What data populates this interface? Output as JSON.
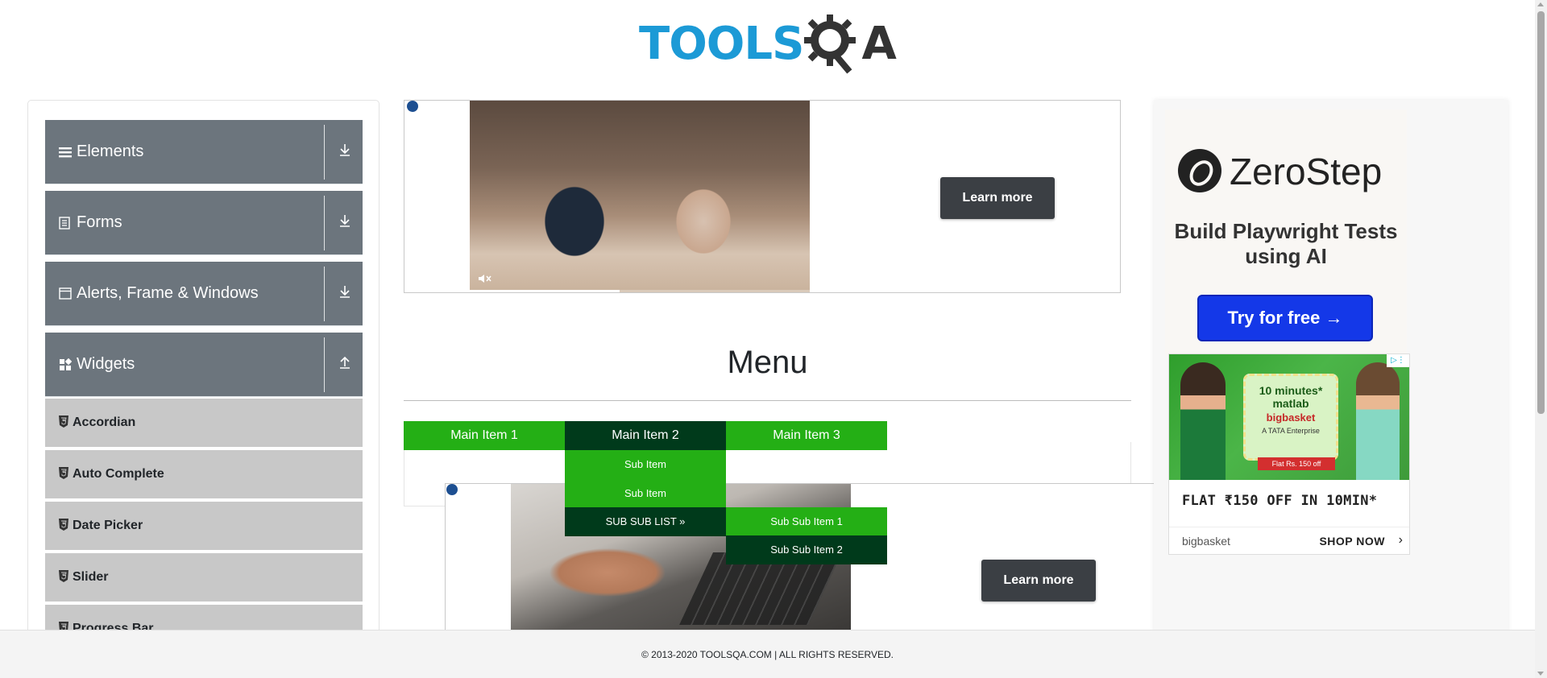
{
  "header": {
    "logo_text_blue": "TOOLS",
    "logo_text_dark": "A"
  },
  "sidebar": {
    "groups": [
      {
        "label": "Elements",
        "icon": "bars-icon",
        "arrow": "download-icon"
      },
      {
        "label": "Forms",
        "icon": "document-icon",
        "arrow": "download-icon"
      },
      {
        "label": "Alerts, Frame & Windows",
        "icon": "window-icon",
        "arrow": "download-icon"
      },
      {
        "label": "Widgets",
        "icon": "widgets-icon",
        "arrow": "upload-icon"
      }
    ],
    "widget_items": [
      {
        "label": "Accordian"
      },
      {
        "label": "Auto Complete"
      },
      {
        "label": "Date Picker"
      },
      {
        "label": "Slider"
      },
      {
        "label": "Progress Bar"
      }
    ]
  },
  "top_ad": {
    "button_label": "Learn more",
    "video_progress": 0.44
  },
  "main": {
    "title": "Menu"
  },
  "menu": {
    "main_items": [
      "Main Item 1",
      "Main Item 2",
      "Main Item 3"
    ],
    "sub_items": [
      "Sub Item",
      "Sub Item",
      "SUB SUB LIST »"
    ],
    "sub_sub_items": [
      "Sub Sub Item 1",
      "Sub Sub Item 2"
    ]
  },
  "second_ad": {
    "button_label": "Learn more"
  },
  "right_ads": {
    "zerostep": {
      "name": "ZeroStep",
      "tagline": "Build Playwright Tests using AI",
      "cta": "Try for free →"
    },
    "bigbasket": {
      "card_line1": "10 minutes* matlab",
      "card_line2": "bigbasket",
      "card_line3": "A TATA Enterprise",
      "offer": "Flat Rs. 150 off",
      "headline": "FLAT ₹150 OFF IN 10MIN*",
      "brand": "bigbasket",
      "shop": "SHOP NOW"
    }
  },
  "footer": {
    "text": "© 2013-2020 TOOLSQA.COM | ALL RIGHTS RESERVED."
  },
  "colors": {
    "menu_green": "#24af15",
    "menu_dark": "#003a1b",
    "sidebar_group": "#6c757d",
    "sidebar_item": "#c8c8c8",
    "logo_blue": "#1c9ad6"
  }
}
